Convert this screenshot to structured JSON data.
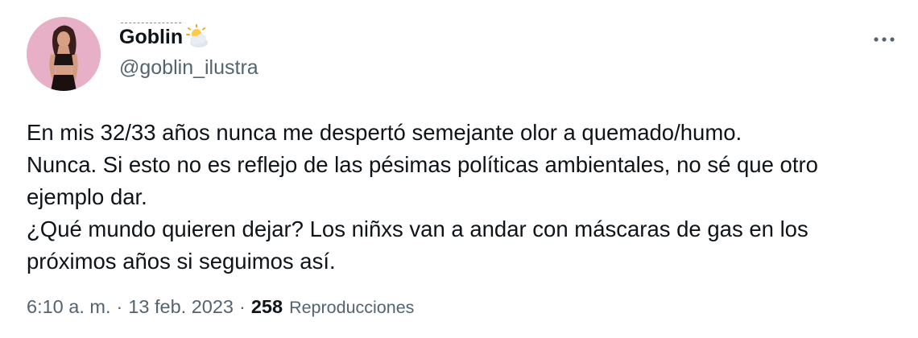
{
  "user": {
    "display_name": "Goblin",
    "handle": "@goblin_ilustra",
    "name_emoji": "sun-behind-cloud-icon"
  },
  "tweet": {
    "text": "En mis 32/33 años nunca me despertó semejante olor a quemado/humo.\nNunca. Si esto no es reflejo de las pésimas políticas ambientales, no sé que otro ejemplo dar.\n¿Qué mundo quieren dejar? Los niñxs van a andar con máscaras de gas en los próximos años si seguimos así.",
    "time": "6:10 a. m.",
    "separator": "·",
    "date": "13 feb. 2023",
    "views_count": "258",
    "views_label": "Reproducciones"
  },
  "colors": {
    "text_primary": "#0f1419",
    "text_secondary": "#536471",
    "avatar_bg": "#e7a6bf"
  }
}
